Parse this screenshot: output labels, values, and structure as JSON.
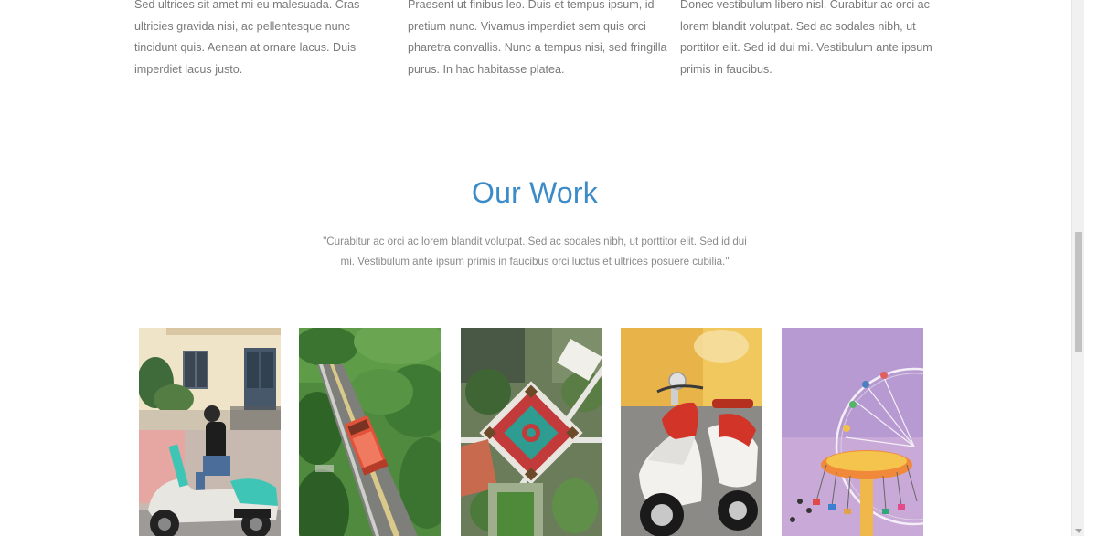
{
  "features": {
    "columns": [
      {
        "text": "Sed ultrices sit amet mi eu malesuada. Cras ultricies gravida nisi, ac pellentesque nunc tincidunt quis. Aenean at ornare lacus. Duis imperdiet lacus justo."
      },
      {
        "text": "Praesent ut finibus leo. Duis et tempus ipsum, id pretium nunc. Vivamus imperdiet sem quis orci pharetra convallis. Nunc a tempus nisi, sed fringilla purus. In hac habitasse platea."
      },
      {
        "text": "Donec vestibulum libero nisl. Curabitur ac orci ac lorem blandit volutpat. Sed ac sodales nibh, ut porttitor elit. Sed id dui mi. Vestibulum ante ipsum primis in faucibus."
      }
    ]
  },
  "our_work": {
    "title": "Our Work",
    "quote": "\"Curabitur ac orci ac lorem blandit volutpat. Sed ac sodales nibh, ut porttitor elit. Sed id dui mi. Vestibulum ante ipsum primis in faucibus orci luctus et ultrices posuere cubilia.\""
  },
  "gallery": {
    "items": [
      {
        "subject": "woman-on-scooter"
      },
      {
        "subject": "bus-on-road-aerial"
      },
      {
        "subject": "aerial-courtyard"
      },
      {
        "subject": "red-white-scooter"
      },
      {
        "subject": "ferris-wheel-swing-ride"
      }
    ]
  },
  "colors": {
    "title": "#3a8bc8",
    "body_text": "#7a7a7a",
    "quote_text": "#8a8a8a",
    "background": "#ffffff"
  }
}
